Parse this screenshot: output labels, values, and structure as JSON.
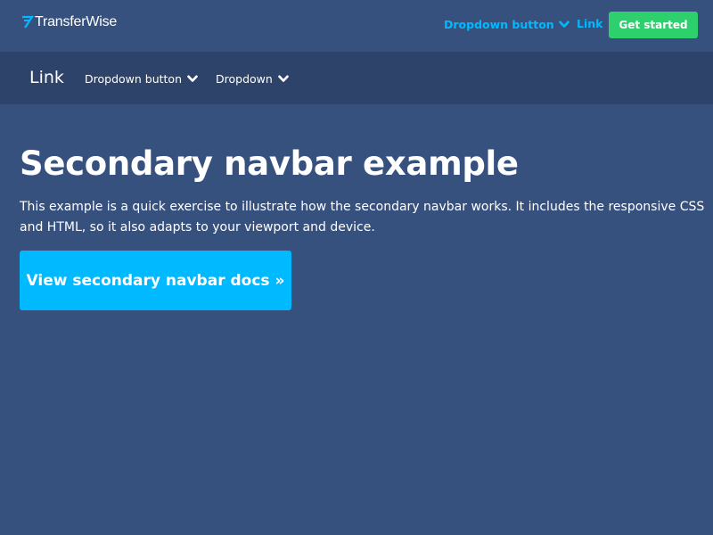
{
  "colors": {
    "background": "#37517e",
    "secondary_bar": "#2e4369",
    "accent": "#00b9ff",
    "success": "#2ed06e",
    "text": "#ffffff"
  },
  "topbar": {
    "brand": {
      "name": "TransferWise",
      "icon": "transferwise-logo-icon"
    },
    "dropdown_label": "Dropdown button",
    "link_label": "Link",
    "cta_label": "Get started"
  },
  "secondary_nav": {
    "title": "Link",
    "items": [
      {
        "label": "Dropdown button",
        "icon": "chevron-down-icon"
      },
      {
        "label": "Dropdown",
        "icon": "chevron-down-icon"
      }
    ]
  },
  "hero": {
    "title": "Secondary navbar example",
    "description": "This example is a quick exercise to illustrate how the secondary navbar works. It includes the responsive CSS and HTML, so it also adapts to your viewport and device.",
    "button_label": "View secondary navbar docs »"
  }
}
